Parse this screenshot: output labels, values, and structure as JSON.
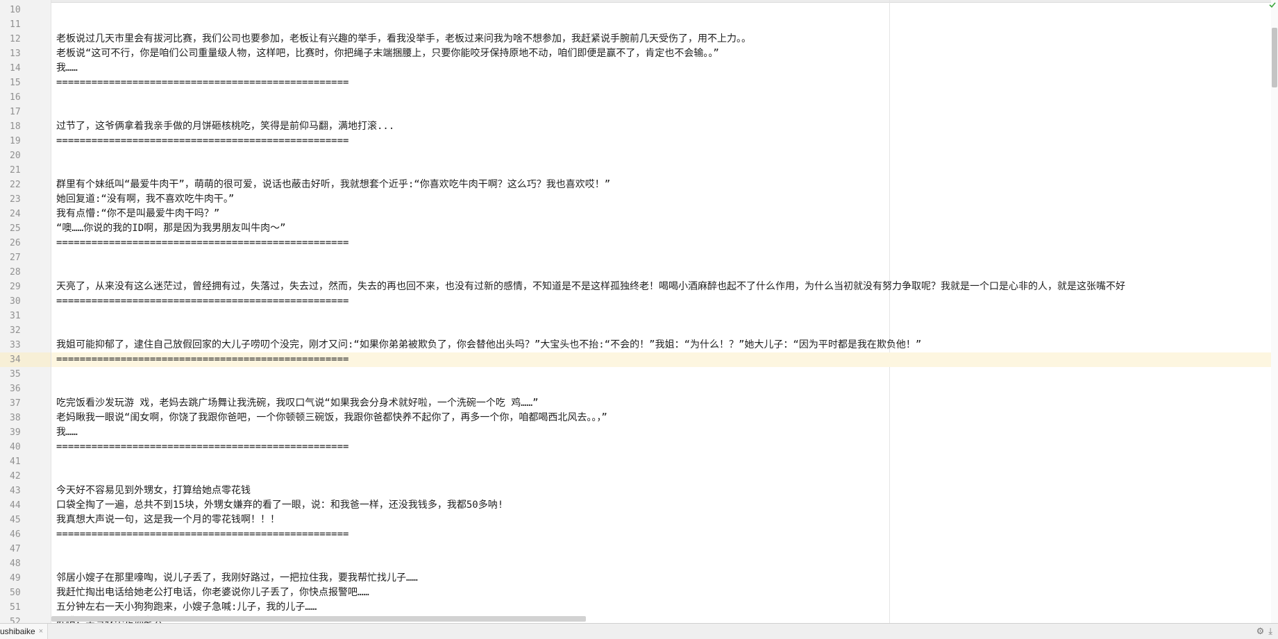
{
  "editor": {
    "line_numbers": [
      "10",
      "11",
      "12",
      "13",
      "14",
      "15",
      "16",
      "17",
      "18",
      "19",
      "20",
      "21",
      "22",
      "23",
      "24",
      "25",
      "26",
      "27",
      "28",
      "29",
      "30",
      "31",
      "32",
      "33",
      "34",
      "35",
      "36",
      "37",
      "38",
      "39",
      "40",
      "41",
      "42",
      "43",
      "44",
      "45",
      "46",
      "47",
      "48",
      "49",
      "50",
      "51",
      "52"
    ],
    "current_line_index": 24,
    "lines": [
      "",
      "",
      "老板说过几天市里会有拔河比赛，我们公司也要参加，老板让有兴趣的举手，看我没举手，老板过来问我为啥不想参加，我赶紧说手腕前几天受伤了，用不上力。。",
      "老板说“这可不行，你是咱们公司重量级人物，这样吧，比赛时，你把绳子末端捆腰上，只要你能咬牙保持原地不动，咱们即便是赢不了，肯定也不会输。。”",
      "我……",
      "==================================================",
      "",
      "",
      "过节了，这爷俩拿着我亲手做的月饼砸核桃吃，笑得是前仰马翻，满地打滚...",
      "==================================================",
      "",
      "",
      "群里有个妹纸叫“最爱牛肉干”，萌萌的很可爱，说话也蔽击好听，我就想套个近乎:“你喜欢吃牛肉干啊？这么巧？我也喜欢哎！”",
      "她回复道:“没有啊，我不喜欢吃牛肉干。”",
      "我有点懵:“你不是叫最爱牛肉干吗？”",
      "“噢……你说的我的ID啊，那是因为我男朋友叫牛肉～”",
      "==================================================",
      "",
      "",
      "天亮了，从来没有这么迷茫过，曾经拥有过，失落过，失去过，然而，失去的再也回不来，也没有过新的感情，不知道是不是这样孤独终老！喝喝小酒麻醉也起不了什么作用，为什么当初就没有努力争取呢？我就是一个口是心非的人，就是这张嘴不好",
      "==================================================",
      "",
      "",
      "我姐可能抑郁了，逮住自己放假回家的大儿子唠叨个没完，刚才又问:“如果你弟弟被欺负了，你会替他出头吗？”大宝头也不抬:“不会的！”我姐：“为什么！？”她大儿子：“因为平时都是我在欺负他！”",
      "==================================================",
      "",
      "",
      "吃完饭看沙发玩游 戏，老妈去跳广场舞让我洗碗，我叹口气说“如果我会分身术就好啦，一个洗碗一个吃 鸡……”",
      "老妈瞅我一眼说“闺女啊，你饶了我跟你爸吧，一个你顿顿三碗饭，我跟你爸都快养不起你了，再多一个你，咱都喝西北风去。。，”",
      "我……",
      "==================================================",
      "",
      "",
      "今天好不容易见到外甥女，打算给她点零花钱",
      "口袋全掏了一遍，总共不到15块，外甥女嫌弃的看了一眼，说：和我爸一样，还没我钱多，我都50多呐!",
      "我真想大声说一句，这是我一个月的零花钱啊！！！",
      "==================================================",
      "",
      "",
      "邻居小嫂子在那里嚎啕，说儿子丢了，我刚好路过，一把拉住我，要我帮忙找儿子……",
      "我赶忙掏出电话给她老公打电话，你老婆说你儿子丢了，你快点报警吧……",
      "五分钟左右一天小狗狗跑来，小嫂子急喊:儿子，我的儿子……",
      "卧槽，幸亏我不是你老公"
    ]
  },
  "tabbar": {
    "tab_label": "ushibaike",
    "close_glyph": "×",
    "gear_glyph": "⚙",
    "download_glyph": "⤓"
  },
  "colors": {
    "current_line": "#fdf6e0",
    "gutter": "#f2f2f2",
    "check": "#3aa63a"
  },
  "icons": [
    "check-icon",
    "close-icon",
    "gear-icon",
    "download-icon"
  ]
}
